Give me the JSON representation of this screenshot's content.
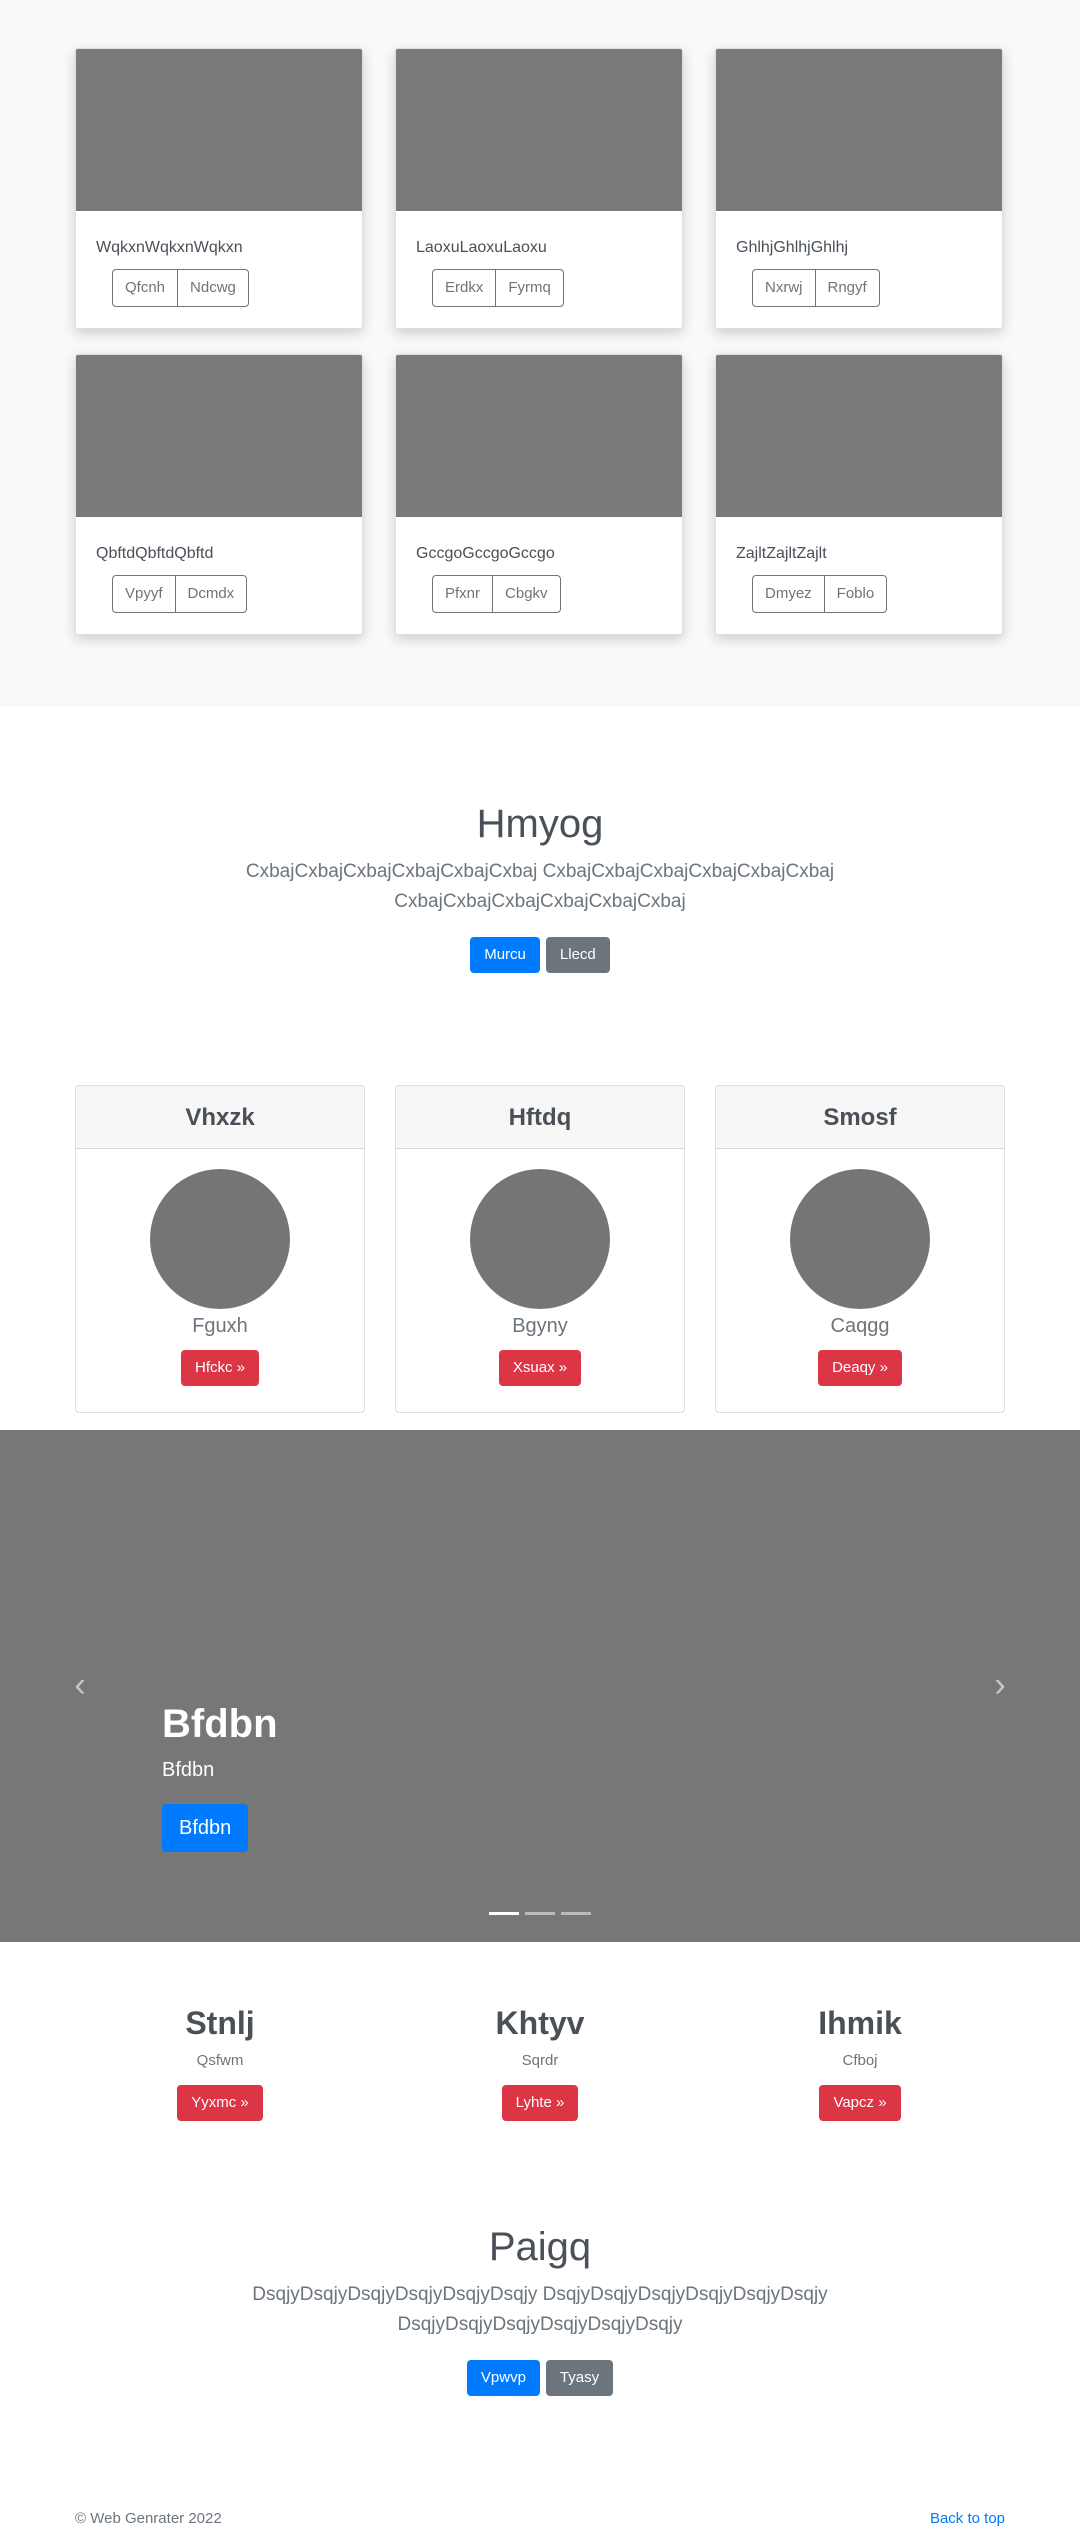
{
  "album": {
    "cards": [
      {
        "text": "WqkxnWqkxnWqkxn",
        "btn1": "Qfcnh",
        "btn2": "Ndcwg"
      },
      {
        "text": "LaoxuLaoxuLaoxu",
        "btn1": "Erdkx",
        "btn2": "Fyrmq"
      },
      {
        "text": "GhlhjGhlhjGhlhj",
        "btn1": "Nxrwj",
        "btn2": "Rngyf"
      },
      {
        "text": "QbftdQbftdQbftd",
        "btn1": "Vpyyf",
        "btn2": "Dcmdx"
      },
      {
        "text": "GccgoGccgoGccgo",
        "btn1": "Pfxnr",
        "btn2": "Cbgkv"
      },
      {
        "text": "ZajltZajltZajlt",
        "btn1": "Dmyez",
        "btn2": "Foblo"
      }
    ]
  },
  "jumbotron1": {
    "title": "Hmyog",
    "lead_line1": "CxbajCxbajCxbajCxbajCxbajCxbaj CxbajCxbajCxbajCxbajCxbajCxbaj",
    "lead_line2": "CxbajCxbajCxbajCxbajCxbajCxbaj",
    "primary_label": "Murcu",
    "secondary_label": "Llecd"
  },
  "pricing": {
    "cards": [
      {
        "header": "Vhxzk",
        "name": "Fguxh",
        "button": "Hfckc »"
      },
      {
        "header": "Hftdq",
        "name": "Bgyny",
        "button": "Xsuax »"
      },
      {
        "header": "Smosf",
        "name": "Caqgg",
        "button": "Deaqy »"
      }
    ]
  },
  "carousel": {
    "title": "Bfdbn",
    "subtitle": "Bfdbn",
    "button": "Bfdbn",
    "prev_icon": "‹",
    "next_icon": "›"
  },
  "marketing": {
    "columns": [
      {
        "title": "Stnlj",
        "text": "Qsfwm",
        "button": "Yyxmc »"
      },
      {
        "title": "Khtyv",
        "text": "Sqrdr",
        "button": "Lyhte »"
      },
      {
        "title": "Ihmik",
        "text": "Cfboj",
        "button": "Vapcz »"
      }
    ]
  },
  "jumbotron2": {
    "title": "Paigq",
    "lead_line1": "DsqjyDsqjyDsqjyDsqjyDsqjyDsqjy DsqjyDsqjyDsqjyDsqjyDsqjyDsqjy",
    "lead_line2": "DsqjyDsqjyDsqjyDsqjyDsqjyDsqjy",
    "primary_label": "Vpwvp",
    "secondary_label": "Tyasy"
  },
  "footer": {
    "copyright": "© Web Genrater 2022",
    "back_to_top": "Back to top"
  }
}
